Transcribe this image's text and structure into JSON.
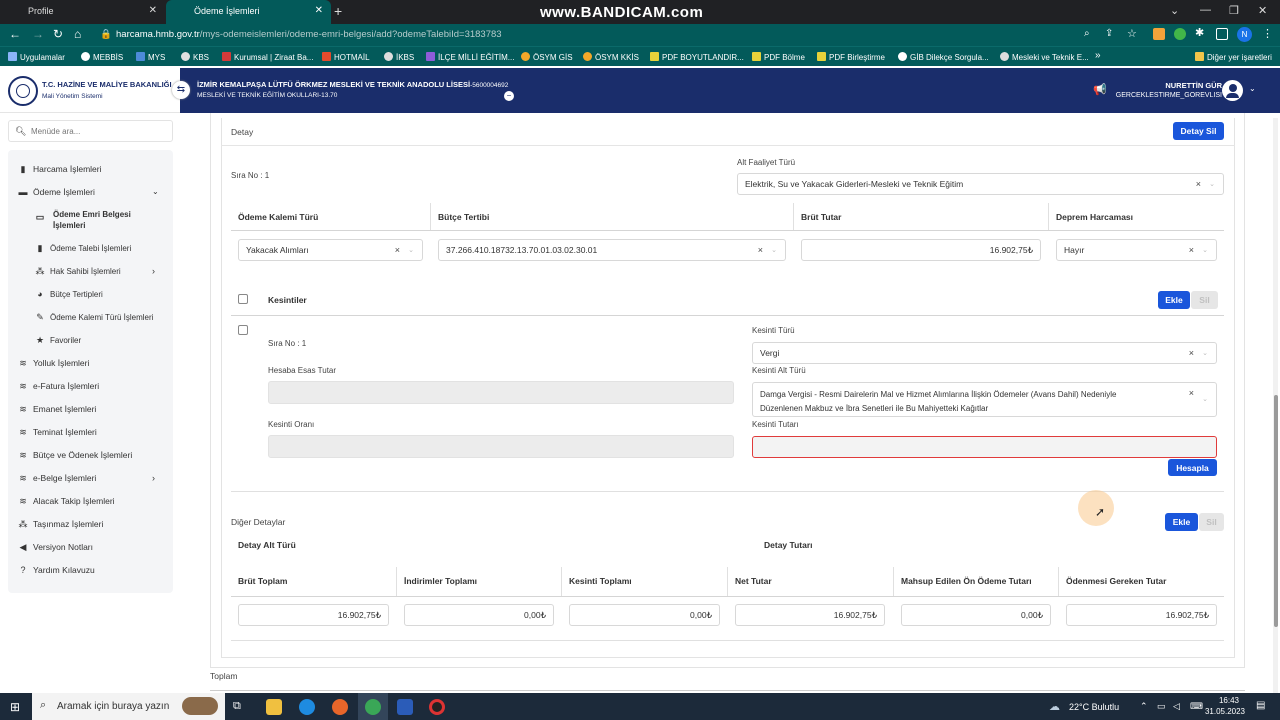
{
  "browser": {
    "tabs": [
      {
        "label": "Profile"
      },
      {
        "label": "Ödeme İşlemleri"
      }
    ],
    "watermark": "www.BANDICAM.com",
    "url_host": "harcama.hmb.gov.tr",
    "url_path": "/mys-odemeislemleri/odeme-emri-belgesi/add?odemeTalebiId=3183783",
    "profile_initial": "N",
    "bookmarks": [
      "Uygulamalar",
      "MEBBİS",
      "MYS",
      "KBS",
      "Kurumsal | Ziraat Ba...",
      "HOTMAİL",
      "İKBS",
      "İLÇE MİLLİ EĞİTİM...",
      "ÖSYM GİS",
      "ÖSYM KKİS",
      "PDF BOYUTLANDIR...",
      "PDF Bölme",
      "PDF Birleştirme",
      "GİB Dilekçe Sorgula...",
      "Mesleki ve Teknik E..."
    ],
    "bookmarks_more": "»",
    "other_bookmarks": "Diğer yer işaretleri"
  },
  "app": {
    "ministry": "T.C. HAZİNE VE MALİYE BAKANLIĞI",
    "system": "Mali Yönetim Sistemi",
    "institution_line1": "İZMİR KEMALPAŞA LÜTFÜ ÖRKMEZ MESLEKİ VE TEKNİK ANADOLU LİSESİ",
    "institution_code": "-5600004692",
    "institution_line2": "MESLEKİ VE TEKNİK EĞİTİM OKULLARI-13.70",
    "user_name": "NURETTİN GÜR",
    "user_role": "GERCEKLESTIRME_GOREVLISI"
  },
  "sidebar": {
    "search_placeholder": "Menüde ara...",
    "items": [
      {
        "label": "Harcama İşlemleri",
        "icon": "receipt-icon"
      },
      {
        "label": "Ödeme İşlemleri",
        "icon": "wallet-icon"
      },
      {
        "label": "Ödeme Emri Belgesi İşlemleri",
        "icon": "document-icon"
      },
      {
        "label": "Ödeme Talebi İşlemleri",
        "icon": "bookmark-icon"
      },
      {
        "label": "Hak Sahibi İşlemleri",
        "icon": "hierarchy-icon"
      },
      {
        "label": "Bütçe Tertipleri",
        "icon": "pie-icon"
      },
      {
        "label": "Ödeme Kalemi Türü İşlemleri",
        "icon": "pen-icon"
      },
      {
        "label": "Favoriler",
        "icon": "star-icon"
      },
      {
        "label": "Yolluk İşlemleri",
        "icon": "coins-icon"
      },
      {
        "label": "e-Fatura İşlemleri",
        "icon": "coins-icon"
      },
      {
        "label": "Emanet İşlemleri",
        "icon": "coins-icon"
      },
      {
        "label": "Teminat İşlemleri",
        "icon": "coins-icon"
      },
      {
        "label": "Bütçe ve Ödenek İşlemleri",
        "icon": "coins-icon"
      },
      {
        "label": "e-Belge İşlemleri",
        "icon": "coins-icon"
      },
      {
        "label": "Alacak Takip İşlemleri",
        "icon": "coins-icon"
      },
      {
        "label": "Taşınmaz İşlemleri",
        "icon": "hierarchy-icon"
      },
      {
        "label": "Versiyon Notları",
        "icon": "megaphone-icon"
      },
      {
        "label": "Yardım Kılavuzu",
        "icon": "question-icon"
      }
    ]
  },
  "detail": {
    "title": "Detay",
    "delete_button": "Detay Sil",
    "sira_no": "Sıra No : 1",
    "alt_faaliyet_label": "Alt Faaliyet Türü",
    "alt_faaliyet_value": "Elektrik, Su ve Yakacak Giderleri-Mesleki ve Teknik Eğitim",
    "odeme_kalemi_label": "Ödeme Kalemi Türü",
    "odeme_kalemi_value": "Yakacak Alımları",
    "butce_tertibi_label": "Bütçe Tertibi",
    "butce_tertibi_value": "37.266.410.18732.13.70.01.03.02.30.01",
    "brut_tutar_label": "Brüt Tutar",
    "brut_tutar_value": "16.902,75₺",
    "deprem_label": "Deprem Harcaması",
    "deprem_value": "Hayır"
  },
  "kesintiler": {
    "title": "Kesintiler",
    "add_button": "Ekle",
    "delete_button": "Sil",
    "sira_no": "Sıra No : 1",
    "hesaba_esas_label": "Hesaba Esas Tutar",
    "kesinti_orani_label": "Kesinti Oranı",
    "kesinti_turu_label": "Kesinti Türü",
    "kesinti_turu_value": "Vergi",
    "kesinti_alt_turu_label": "Kesinti Alt Türü",
    "kesinti_alt_turu_value1": "Damga Vergisi - Resmi Dairelerin Mal ve Hizmet Alımlarına İlişkin Ödemeler (Avans Dahil) Nedeniyle",
    "kesinti_alt_turu_value2": "Düzenlenen Makbuz ve İbra Senetleri ile Bu Mahiyetteki Kağıtlar",
    "kesinti_tutari_label": "Kesinti Tutarı",
    "hesapla_button": "Hesapla"
  },
  "diger": {
    "title": "Diğer Detaylar",
    "add_button": "Ekle",
    "delete_button": "Sil",
    "detay_alt_turu": "Detay Alt Türü",
    "detay_tutari": "Detay Tutarı"
  },
  "totals": {
    "columns": [
      {
        "label": "Brüt Toplam",
        "value": "16.902,75₺"
      },
      {
        "label": "İndirimler Toplamı",
        "value": "0,00₺"
      },
      {
        "label": "Kesinti Toplamı",
        "value": "0,00₺"
      },
      {
        "label": "Net Tutar",
        "value": "16.902,75₺"
      },
      {
        "label": "Mahsup Edilen Ön Ödeme Tutarı",
        "value": "0,00₺"
      },
      {
        "label": "Ödenmesi Gereken Tutar",
        "value": "16.902,75₺"
      }
    ],
    "toplam": "Toplam"
  },
  "taskbar": {
    "search_placeholder": "Aramak için buraya yazın",
    "weather": "22°C Bulutlu",
    "time": "16:43",
    "date": "31.05.2023"
  }
}
